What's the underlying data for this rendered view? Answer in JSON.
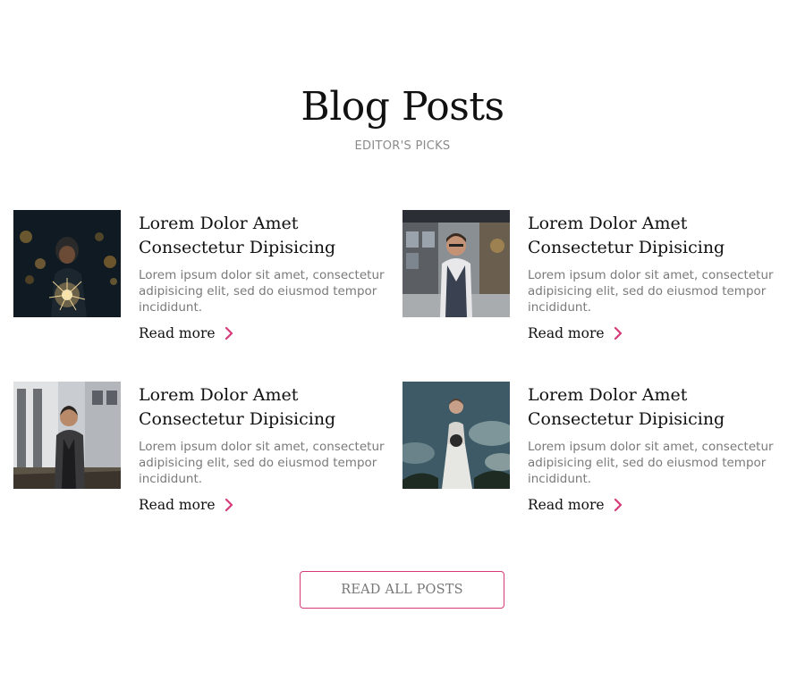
{
  "header": {
    "title": "Blog Posts",
    "subtitle": "EDITOR'S PICKS"
  },
  "posts": [
    {
      "title_line1": "Lorem Dolor Amet",
      "title_line2": "Consectetur Dipisicing",
      "excerpt": "Lorem ipsum dolor sit amet, consectetur adipisicing elit, sed do eiusmod tempor incididunt.",
      "read_more": "Read more",
      "image": "person-with-sparkler-photo"
    },
    {
      "title_line1": "Lorem Dolor Amet",
      "title_line2": "Consectetur Dipisicing",
      "excerpt": "Lorem ipsum dolor sit amet, consectetur adipisicing elit, sed do eiusmod tempor incididunt.",
      "read_more": "Read more",
      "image": "man-in-vest-street-photo"
    },
    {
      "title_line1": "Lorem Dolor Amet",
      "title_line2": "Consectetur Dipisicing",
      "excerpt": "Lorem ipsum dolor sit amet, consectetur adipisicing elit, sed do eiusmod tempor incididunt.",
      "read_more": "Read more",
      "image": "man-in-jacket-building-photo"
    },
    {
      "title_line1": "Lorem Dolor Amet",
      "title_line2": "Consectetur Dipisicing",
      "excerpt": "Lorem ipsum dolor sit amet, consectetur adipisicing elit, sed do eiusmod tempor incididunt.",
      "read_more": "Read more",
      "image": "bride-with-bouquet-photo"
    }
  ],
  "button": {
    "label": "READ ALL POSTS"
  },
  "colors": {
    "accent": "#d63a78",
    "text": "#111111",
    "muted": "#7a7a7a"
  }
}
